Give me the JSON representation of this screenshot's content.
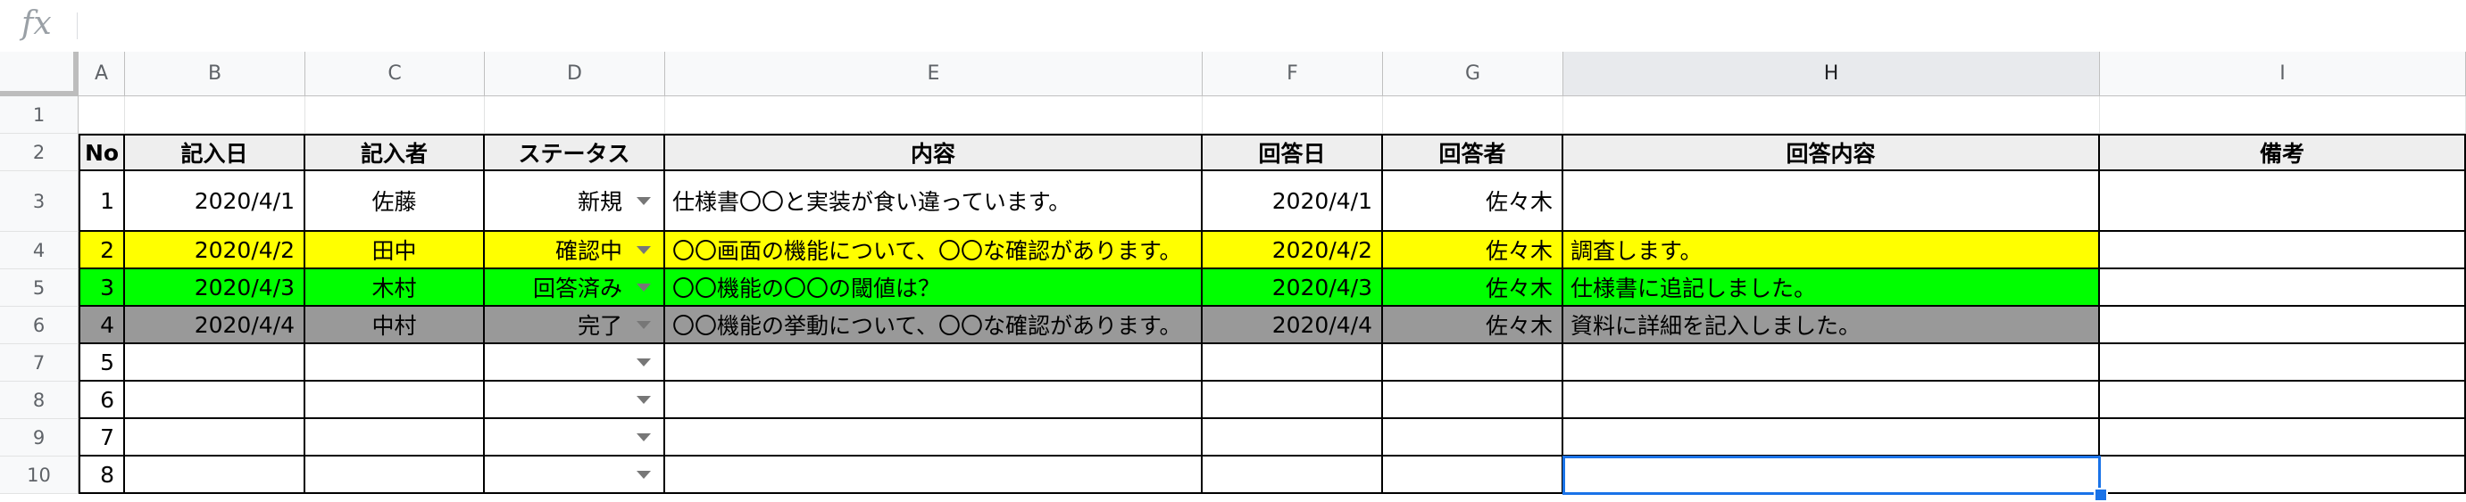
{
  "formula_bar": {
    "icon": "fx-icon",
    "value": ""
  },
  "columns": [
    "A",
    "B",
    "C",
    "D",
    "E",
    "F",
    "G",
    "H",
    "I"
  ],
  "selected_column": "H",
  "row_numbers": [
    "1",
    "2",
    "3",
    "4",
    "5",
    "6",
    "7",
    "8",
    "9",
    "10"
  ],
  "table": {
    "headers": [
      "No",
      "記入日",
      "記入者",
      "ステータス",
      "内容",
      "回答日",
      "回答者",
      "回答内容",
      "備考"
    ],
    "rows": [
      {
        "no": "1",
        "date": "2020/4/1",
        "author": "佐藤",
        "status": "新規",
        "content": "仕様書〇〇と実装が食い違っています。",
        "reply_date": "2020/4/1",
        "replier": "佐々木",
        "reply": "",
        "note": "",
        "color": ""
      },
      {
        "no": "2",
        "date": "2020/4/2",
        "author": "田中",
        "status": "確認中",
        "content": "〇〇画面の機能について、〇〇な確認があります。",
        "reply_date": "2020/4/2",
        "replier": "佐々木",
        "reply": "調査します。",
        "note": "",
        "color": "#ffff00"
      },
      {
        "no": "3",
        "date": "2020/4/3",
        "author": "木村",
        "status": "回答済み",
        "content": "〇〇機能の〇〇の閾値は？",
        "reply_date": "2020/4/3",
        "replier": "佐々木",
        "reply": "仕様書に追記しました。",
        "note": "",
        "color": "#00ff00"
      },
      {
        "no": "4",
        "date": "2020/4/4",
        "author": "中村",
        "status": "完了",
        "content": "〇〇機能の挙動について、〇〇な確認があります。",
        "reply_date": "2020/4/4",
        "replier": "佐々木",
        "reply": "資料に詳細を記入しました。",
        "note": "",
        "color": "#999999"
      },
      {
        "no": "5",
        "date": "",
        "author": "",
        "status": "",
        "content": "",
        "reply_date": "",
        "replier": "",
        "reply": "",
        "note": "",
        "color": ""
      },
      {
        "no": "6",
        "date": "",
        "author": "",
        "status": "",
        "content": "",
        "reply_date": "",
        "replier": "",
        "reply": "",
        "note": "",
        "color": ""
      },
      {
        "no": "7",
        "date": "",
        "author": "",
        "status": "",
        "content": "",
        "reply_date": "",
        "replier": "",
        "reply": "",
        "note": "",
        "color": ""
      },
      {
        "no": "8",
        "date": "",
        "author": "",
        "status": "",
        "content": "",
        "reply_date": "",
        "replier": "",
        "reply": "",
        "note": "",
        "color": ""
      }
    ]
  },
  "selected_cell": "H10",
  "colors": {
    "selection": "#1a73e8",
    "yellow": "#ffff00",
    "green": "#00ff00",
    "gray": "#999999"
  }
}
